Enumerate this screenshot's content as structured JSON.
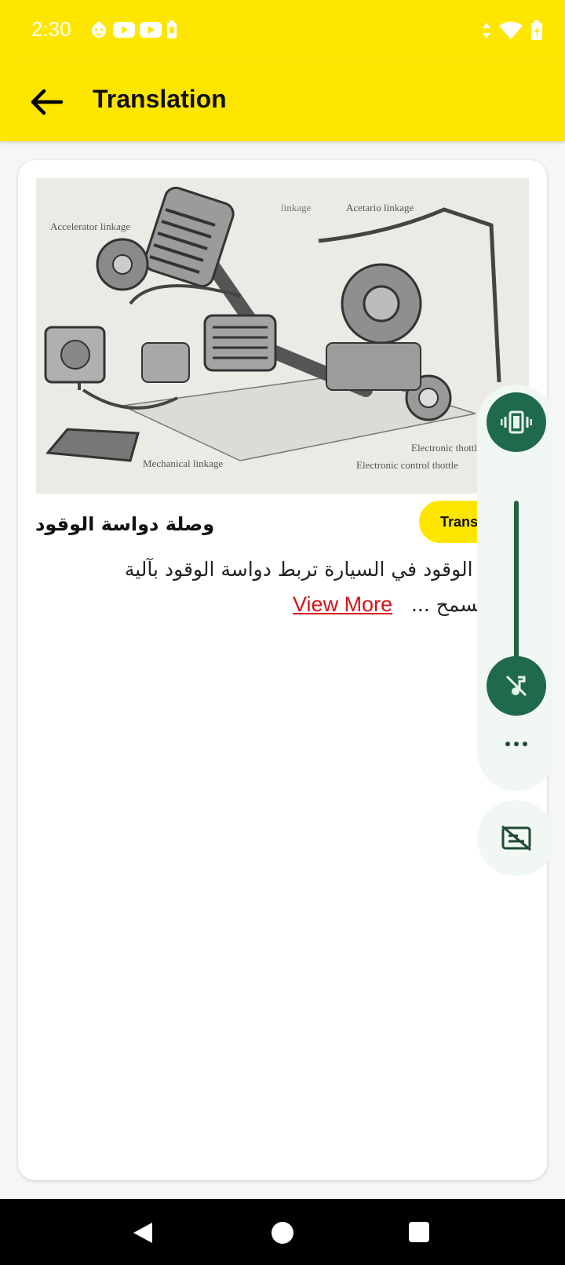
{
  "status_bar": {
    "time": "2:30",
    "icons_left": [
      "bug-face-icon",
      "youtube-icon",
      "youtube-icon",
      "battery-saver-icon"
    ],
    "icons_right": [
      "data-arrows-icon",
      "wifi-icon",
      "battery-icon"
    ]
  },
  "app_bar": {
    "title": "Translation",
    "back_icon": "arrow-back-icon"
  },
  "card": {
    "figure_labels": {
      "top_left": "Accelerator linkage",
      "top_center": "linkage",
      "top_right": "Acetario linkage",
      "bottom_left": "Mechanical linkage",
      "bottom_right_1": "Electronic thottle",
      "bottom_right_2": "Electronic control thottle"
    },
    "title": "وصلة دواسة الوقود",
    "translate_button": "Trans",
    "description_line1": "دواسة الوقود في السيارة تربط دواسة الوقود بآلية",
    "description_line2": "، مما يسمح ...",
    "view_more": "View More"
  },
  "volume_panel": {
    "ring_mode_icon": "vibrate-icon",
    "mute_icon": "music-off-icon",
    "more_icon": "more-horiz-icon",
    "caption_icon": "captions-off-icon",
    "level": 0.0,
    "accent_color": "#1f6a4c"
  },
  "nav_bar": {
    "back": "nav-back-icon",
    "home": "nav-home-icon",
    "recents": "nav-recents-icon"
  },
  "colors": {
    "brand": "#ffe600",
    "link": "#d6141b"
  }
}
